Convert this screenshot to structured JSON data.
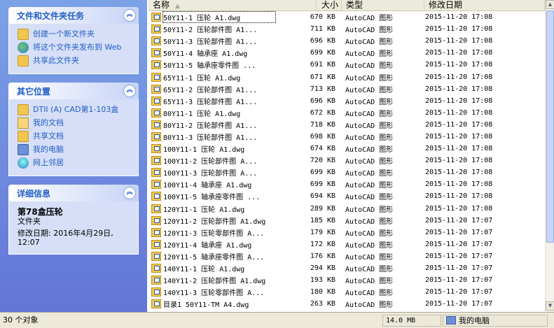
{
  "taskpane": {
    "file_tasks": {
      "title": "文件和文件夹任务",
      "collapse": "︽",
      "items": [
        {
          "label": "创建一个新文件夹",
          "icon": "new-folder-icon"
        },
        {
          "label": "将这个文件夹发布到 Web",
          "icon": "publish-web-icon"
        },
        {
          "label": "共享此文件夹",
          "icon": "share-folder-icon"
        }
      ]
    },
    "other_places": {
      "title": "其它位置",
      "collapse": "︽",
      "items": [
        {
          "label": "DTII (A) CAD第1-103盒",
          "icon": "folder-icon"
        },
        {
          "label": "我的文档",
          "icon": "my-documents-icon"
        },
        {
          "label": "共享文档",
          "icon": "shared-documents-icon"
        },
        {
          "label": "我的电脑",
          "icon": "my-computer-icon"
        },
        {
          "label": "网上邻居",
          "icon": "network-icon"
        }
      ]
    },
    "details": {
      "title": "详细信息",
      "collapse": "︽",
      "name": "第78盒压轮",
      "kind": "文件夹",
      "modified": "修改日期: 2016年4月29日, 12:07"
    }
  },
  "list": {
    "headers": {
      "name": "名称",
      "size": "大小",
      "type": "类型",
      "date": "修改日期"
    },
    "rows": [
      {
        "name": "50Y11-1 压轮   A1.dwg",
        "size": "670 KB",
        "type": "AutoCAD 图形",
        "date": "2015-11-20 17:08"
      },
      {
        "name": "50Y11-2 压轮部件图   A1...",
        "size": "711 KB",
        "type": "AutoCAD 图形",
        "date": "2015-11-20 17:08"
      },
      {
        "name": "50Y11-3 压轮部件图   A1...",
        "size": "696 KB",
        "type": "AutoCAD 图形",
        "date": "2015-11-20 17:08"
      },
      {
        "name": "50Y11-4 轴承座   A1.dwg",
        "size": "699 KB",
        "type": "AutoCAD 图形",
        "date": "2015-11-20 17:08"
      },
      {
        "name": "50Y11-5 轴承座零件图   ...",
        "size": "691 KB",
        "type": "AutoCAD 图形",
        "date": "2015-11-20 17:08"
      },
      {
        "name": "65Y11-1 压轮   A1.dwg",
        "size": "671 KB",
        "type": "AutoCAD 图形",
        "date": "2015-11-20 17:08"
      },
      {
        "name": "65Y11-2 压轮部件图   A1...",
        "size": "713 KB",
        "type": "AutoCAD 图形",
        "date": "2015-11-20 17:08"
      },
      {
        "name": "65Y11-3 压轮部件图   A1...",
        "size": "696 KB",
        "type": "AutoCAD 图形",
        "date": "2015-11-20 17:08"
      },
      {
        "name": "80Y11-1 压轮   A1.dwg",
        "size": "672 KB",
        "type": "AutoCAD 图形",
        "date": "2015-11-20 17:08"
      },
      {
        "name": "80Y11-2 压轮部件图   A1...",
        "size": "718 KB",
        "type": "AutoCAD 图形",
        "date": "2015-11-20 17:08"
      },
      {
        "name": "80Y11-3 压轮部件图   A1...",
        "size": "698 KB",
        "type": "AutoCAD 图形",
        "date": "2015-11-20 17:08"
      },
      {
        "name": "100Y11-1 压轮   A1.dwg",
        "size": "674 KB",
        "type": "AutoCAD 图形",
        "date": "2015-11-20 17:08"
      },
      {
        "name": "100Y11-2 压轮部件图   A...",
        "size": "720 KB",
        "type": "AutoCAD 图形",
        "date": "2015-11-20 17:08"
      },
      {
        "name": "100Y11-3 压轮部件图   A...",
        "size": "699 KB",
        "type": "AutoCAD 图形",
        "date": "2015-11-20 17:08"
      },
      {
        "name": "100Y11-4 轴承座   A1.dwg",
        "size": "699 KB",
        "type": "AutoCAD 图形",
        "date": "2015-11-20 17:08"
      },
      {
        "name": "100Y11-5 轴承座零件图   ...",
        "size": "694 KB",
        "type": "AutoCAD 图形",
        "date": "2015-11-20 17:08"
      },
      {
        "name": "120Y11-1  压轮  A1.dwg",
        "size": "289 KB",
        "type": "AutoCAD 图形",
        "date": "2015-11-20 17:08"
      },
      {
        "name": "120Y11-2 压轮部件图 A1.dwg",
        "size": "185 KB",
        "type": "AutoCAD 图形",
        "date": "2015-11-20 17:07"
      },
      {
        "name": "120Y11-3 压轮零部件图 A...",
        "size": "179 KB",
        "type": "AutoCAD 图形",
        "date": "2015-11-20 17:07"
      },
      {
        "name": "120Y11-4 轴承座 A1.dwg",
        "size": "172 KB",
        "type": "AutoCAD 图形",
        "date": "2015-11-20 17:07"
      },
      {
        "name": "120Y11-5 轴承座零件图 A...",
        "size": "176 KB",
        "type": "AutoCAD 图形",
        "date": "2015-11-20 17:07"
      },
      {
        "name": "140Y11-1  压轮  A1.dwg",
        "size": "294 KB",
        "type": "AutoCAD 图形",
        "date": "2015-11-20 17:07"
      },
      {
        "name": "140Y11-2 压轮部件图 A1.dwg",
        "size": "193 KB",
        "type": "AutoCAD 图形",
        "date": "2015-11-20 17:07"
      },
      {
        "name": "140Y11-3 压轮零部件图 A...",
        "size": "180 KB",
        "type": "AutoCAD 图形",
        "date": "2015-11-20 17:07"
      },
      {
        "name": "目录1 50Y11-TM A4.dwg",
        "size": "263 KB",
        "type": "AutoCAD 图形",
        "date": "2015-11-20 17:07"
      }
    ]
  },
  "statusbar": {
    "count": "30 个对象",
    "size": "14.0 MB",
    "location": "我的电脑"
  }
}
